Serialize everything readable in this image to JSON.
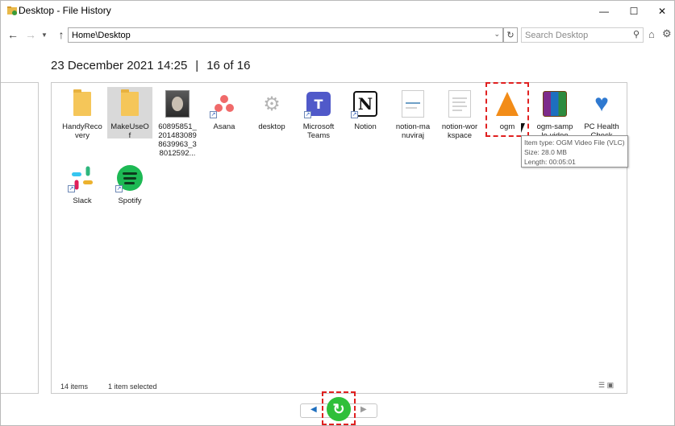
{
  "window": {
    "title": "Desktop - File History"
  },
  "toolbar": {
    "address": "Home\\Desktop",
    "search_placeholder": "Search Desktop"
  },
  "header": {
    "date": "23 December 2021 14:25",
    "position": "16 of 16"
  },
  "items": [
    {
      "line1": "HandyReco",
      "line2": "very",
      "line3": ""
    },
    {
      "line1": "MakeUseO",
      "line2": "f",
      "line3": ""
    },
    {
      "line1": "60895851_",
      "line2": "201483089",
      "line3": "8639963_3",
      "line4": "8012592..."
    },
    {
      "line1": "Asana",
      "line2": ""
    },
    {
      "line1": "desktop",
      "line2": ""
    },
    {
      "line1": "Microsoft",
      "line2": "Teams"
    },
    {
      "line1": "Notion",
      "line2": ""
    },
    {
      "line1": "notion-ma",
      "line2": "nuviraj"
    },
    {
      "line1": "notion-wor",
      "line2": "kspace"
    },
    {
      "line1": "ogm",
      "line2": ""
    },
    {
      "line1": "ogm-samp",
      "line2": "le-video"
    },
    {
      "line1": "PC Health",
      "line2": "Check"
    },
    {
      "line1": "Slack",
      "line2": ""
    },
    {
      "line1": "Spotify",
      "line2": ""
    }
  ],
  "tooltip": {
    "type": "Item type: OGM Video File (VLC)",
    "size": "Size: 28.0 MB",
    "length": "Length: 00:05:01"
  },
  "status": {
    "count": "14 items",
    "selected": "1 item selected"
  },
  "colors": {
    "highlight": "#e02020",
    "restore_button": "#2fbf3a"
  }
}
